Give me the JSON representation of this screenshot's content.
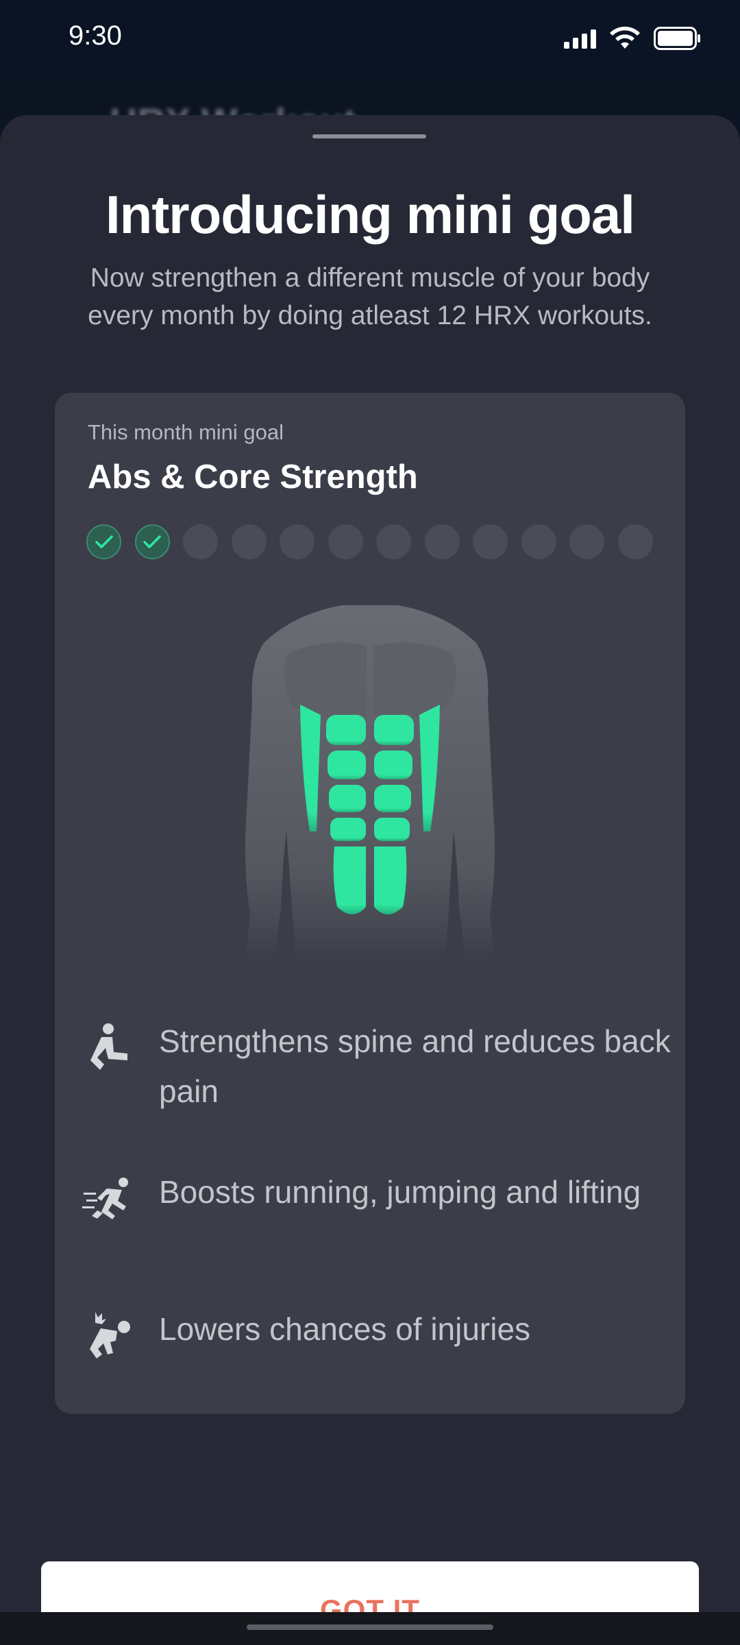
{
  "status_bar": {
    "time": "9:30"
  },
  "background": {
    "back_label": "‹",
    "title": "HRX Workout"
  },
  "sheet": {
    "title": "Introducing mini goal",
    "subtitle": "Now strengthen a different muscle of your body every month by doing atleast 12 HRX workouts."
  },
  "goal_card": {
    "caption": "This month mini goal",
    "name": "Abs & Core Strength",
    "progress": {
      "completed": 2,
      "total": 12
    },
    "highlight_color": "#2ee6a0"
  },
  "benefits": [
    {
      "icon": "stretching-person-icon",
      "text": "Strengthens spine and reduces back pain"
    },
    {
      "icon": "running-person-icon",
      "text": "Boosts  running, jumping and lifting"
    },
    {
      "icon": "injury-person-icon",
      "text": "Lowers chances of injuries"
    }
  ],
  "cta": {
    "label": "GOT IT",
    "color": "#e8735e"
  }
}
